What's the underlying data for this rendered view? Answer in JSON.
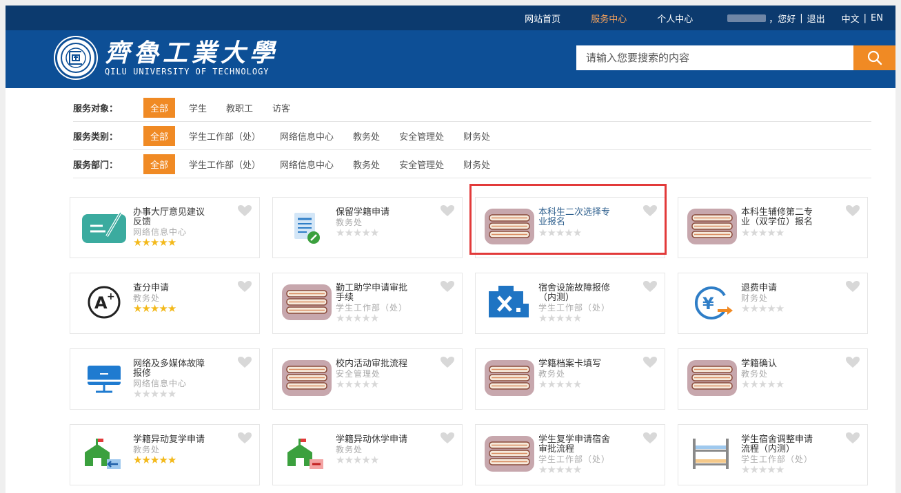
{
  "topnav": {
    "home": "网站首页",
    "service": "服务中心",
    "personal": "个人中心",
    "greeting": "，您好",
    "divider": "|",
    "logout": "退出",
    "lang_cn": "中文",
    "lang_en": "EN"
  },
  "logo": {
    "cn": "齊魯工業大學",
    "en": "QILU UNIVERSITY OF TECHNOLOGY"
  },
  "search": {
    "placeholder": "请输入您要搜索的内容"
  },
  "filters": [
    {
      "label": "服务对象：",
      "options": [
        "全部",
        "学生",
        "教职工",
        "访客"
      ]
    },
    {
      "label": "服务类别：",
      "options": [
        "全部",
        "学生工作部（处）",
        "网络信息中心",
        "教务处",
        "安全管理处",
        "财务处"
      ]
    },
    {
      "label": "服务部门：",
      "options": [
        "全部",
        "学生工作部（处）",
        "网络信息中心",
        "教务处",
        "安全管理处",
        "财务处"
      ]
    }
  ],
  "colors": {
    "nav_dark": "#0c3a6e",
    "header_blue": "#0d4f96",
    "accent_orange": "#f08a24",
    "highlight_red": "#e23a3a",
    "star_gold": "#f3b91b"
  },
  "services": [
    {
      "l1": "办事大厅意见建议",
      "l2": "反馈",
      "dept": "网络信息中心",
      "rating": 4.5,
      "icon": "feedback-icon"
    },
    {
      "l1": "保留学籍申请",
      "l2": "",
      "dept": "教务处",
      "rating": 0,
      "icon": "document-edit-icon"
    },
    {
      "l1": "本科生二次选择专",
      "l2": "业报名",
      "dept": "",
      "rating": 0,
      "icon": "book-stack-icon",
      "highlight": true
    },
    {
      "l1": "本科生辅修第二专",
      "l2": "业（双学位）报名",
      "dept": "",
      "rating": 0,
      "icon": "book-stack-icon"
    },
    {
      "l1": "查分申请",
      "l2": "",
      "dept": "教务处",
      "rating": 5,
      "icon": "grade-a-plus-icon"
    },
    {
      "l1": "勤工助学申请审批",
      "l2": "手续",
      "dept": "学生工作部（处）",
      "rating": 0,
      "icon": "book-stack-icon"
    },
    {
      "l1": "宿舍设施故障报修",
      "l2": "（内测）",
      "dept": "学生工作部（处）",
      "rating": 0,
      "icon": "repair-tools-icon"
    },
    {
      "l1": "退费申请",
      "l2": "",
      "dept": "财务处",
      "rating": 0,
      "icon": "refund-yen-icon"
    },
    {
      "l1": "网络及多媒体故障",
      "l2": "报修",
      "dept": "网络信息中心",
      "rating": 0,
      "icon": "monitor-repair-icon"
    },
    {
      "l1": "校内活动审批流程",
      "l2": "",
      "dept": "安全管理处",
      "rating": 0,
      "icon": "book-stack-icon"
    },
    {
      "l1": "学籍档案卡填写",
      "l2": "",
      "dept": "教务处",
      "rating": 0,
      "icon": "book-stack-icon"
    },
    {
      "l1": "学籍确认",
      "l2": "",
      "dept": "教务处",
      "rating": 0,
      "icon": "book-stack-icon"
    },
    {
      "l1": "学籍异动复学申请",
      "l2": "",
      "dept": "教务处",
      "rating": 5,
      "icon": "school-return-icon"
    },
    {
      "l1": "学籍异动休学申请",
      "l2": "",
      "dept": "教务处",
      "rating": 0,
      "icon": "school-leave-icon"
    },
    {
      "l1": "学生复学申请宿舍",
      "l2": "审批流程",
      "dept": "学生工作部（处）",
      "rating": 0,
      "icon": "book-stack-icon"
    },
    {
      "l1": "学生宿舍调整申请",
      "l2": "流程（内测）",
      "dept": "学生工作部（处）",
      "rating": 0,
      "icon": "bunk-bed-icon"
    }
  ]
}
